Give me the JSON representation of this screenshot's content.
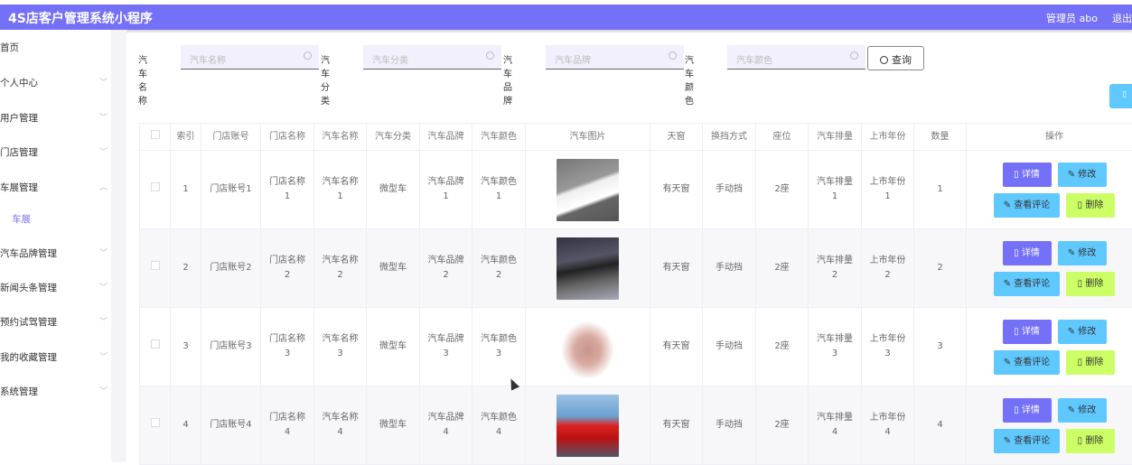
{
  "header": {
    "title": "4S店客户管理系统小程序",
    "user": "管理员 abo",
    "logout": "退出"
  },
  "sidebar": {
    "items": [
      {
        "label": "首页",
        "chevron": false
      },
      {
        "label": "个人中心",
        "chevron": true
      },
      {
        "label": "用户管理",
        "chevron": true
      },
      {
        "label": "门店管理",
        "chevron": true
      },
      {
        "label": "车展管理",
        "chevron": true,
        "expanded": true
      },
      {
        "label": "车展",
        "sub": true
      },
      {
        "label": "汽车品牌管理",
        "chevron": true
      },
      {
        "label": "新闻头条管理",
        "chevron": true
      },
      {
        "label": "预约试驾管理",
        "chevron": true
      },
      {
        "label": "我的收藏管理",
        "chevron": true
      },
      {
        "label": "系统管理",
        "chevron": true
      }
    ]
  },
  "search": {
    "fields": [
      {
        "label": "汽车名称",
        "placeholder": "汽车名称"
      },
      {
        "label": "汽车分类",
        "placeholder": "汽车分类"
      },
      {
        "label": "汽车品牌",
        "placeholder": "汽车品牌"
      },
      {
        "label": "汽车颜色",
        "placeholder": "汽车颜色"
      }
    ],
    "query_label": "查询"
  },
  "table": {
    "columns": [
      "索引",
      "门店账号",
      "门店名称",
      "汽车名称",
      "汽车分类",
      "汽车品牌",
      "汽车颜色",
      "汽车图片",
      "天窗",
      "换挡方式",
      "座位",
      "汽车排量",
      "上市年份",
      "数量",
      "操作"
    ],
    "rows": [
      [
        "1",
        "门店账号1",
        "门店名称1",
        "汽车名称1",
        "微型车",
        "汽车品牌1",
        "汽车颜色1",
        "",
        "有天窗",
        "手动挡",
        "2座",
        "汽车排量1",
        "上市年份1",
        "1"
      ],
      [
        "2",
        "门店账号2",
        "门店名称2",
        "汽车名称2",
        "微型车",
        "汽车品牌2",
        "汽车颜色2",
        "",
        "有天窗",
        "手动挡",
        "2座",
        "汽车排量2",
        "上市年份2",
        "2"
      ],
      [
        "3",
        "门店账号3",
        "门店名称3",
        "汽车名称3",
        "微型车",
        "汽车品牌3",
        "汽车颜色3",
        "",
        "有天窗",
        "手动挡",
        "2座",
        "汽车排量3",
        "上市年份3",
        "3"
      ],
      [
        "4",
        "门店账号4",
        "门店名称4",
        "汽车名称4",
        "微型车",
        "汽车品牌4",
        "汽车颜色4",
        "",
        "有天窗",
        "手动挡",
        "2座",
        "汽车排量4",
        "上市年份4",
        "4"
      ]
    ],
    "images": [
      "white-convertible",
      "dark-sports-car",
      "pink-coupe",
      "red-convertible"
    ],
    "actions": {
      "detail": "详情",
      "edit": "修改",
      "view_comments": "查看评论",
      "delete": "删除"
    }
  },
  "colors": {
    "primary": "#7470f8",
    "info": "#5fc8ff",
    "danger": "#ccff66"
  }
}
